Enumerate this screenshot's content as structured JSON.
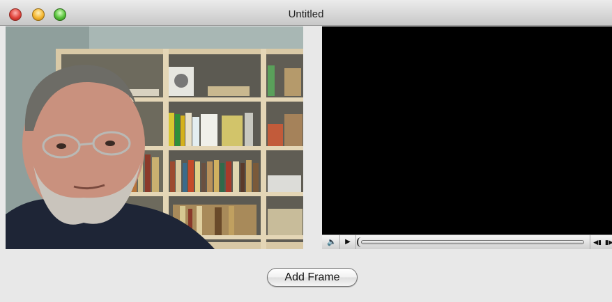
{
  "window": {
    "title": "Untitled",
    "traffic_lights": [
      {
        "name": "close-button",
        "icon": "close-icon",
        "color": "#e0443b"
      },
      {
        "name": "minimize-button",
        "icon": "minimize-icon",
        "color": "#f4b630"
      },
      {
        "name": "zoom-button",
        "icon": "zoom-icon",
        "color": "#57c23a"
      }
    ]
  },
  "camera_view": {
    "content": "live-camera-preview",
    "subject": "man-in-front-of-bookshelf"
  },
  "movie_view": {
    "background": "#000000",
    "controller": {
      "volume_icon": "speaker-icon",
      "play_icon": "play-icon",
      "step_back_icon": "step-back-icon",
      "step_forward_icon": "step-forward-icon",
      "playhead": 0
    }
  },
  "actions": {
    "add_frame_label": "Add Frame"
  }
}
